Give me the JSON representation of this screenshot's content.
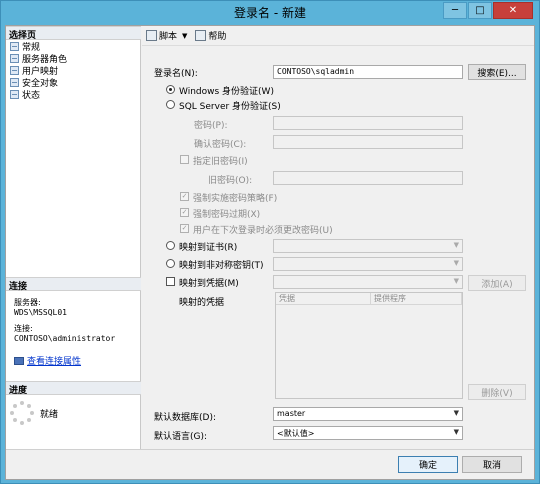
{
  "window": {
    "title": "登录名 - 新建",
    "minimize": "─",
    "maximize": "□",
    "close": "✕"
  },
  "left": {
    "pages_header": "选择页",
    "pages": [
      "常规",
      "服务器角色",
      "用户映射",
      "安全对象",
      "状态"
    ],
    "connection_header": "连接",
    "server_label": "服务器:",
    "server_value": "WDS\\MSSQL01",
    "connection_label": "连接:",
    "connection_value": "CONTOSO\\administrator",
    "view_props_link": "查看连接属性",
    "progress_header": "进度",
    "progress_status": "就绪"
  },
  "toolbar": {
    "script": "脚本",
    "script_arrow": "▼",
    "help": "帮助"
  },
  "form": {
    "login_name_label": "登录名(N):",
    "login_name_value": "CONTOSO\\sqladmin",
    "search_button": "搜索(E)...",
    "windows_auth": "Windows 身份验证(W)",
    "sql_auth": "SQL Server 身份验证(S)",
    "password_label": "密码(P):",
    "confirm_password_label": "确认密码(C):",
    "specify_old_password": "指定旧密码(I)",
    "old_password_label": "旧密码(O):",
    "enforce_policy": "强制实施密码策略(F)",
    "enforce_expiration": "强制密码过期(X)",
    "must_change": "用户在下次登录时必须更改密码(U)",
    "map_certificate": "映射到证书(R)",
    "map_asymmetric_key": "映射到非对称密钥(T)",
    "map_credential": "映射到凭据(M)",
    "add_button": "添加(A)",
    "mapped_credentials_label": "映射的凭据",
    "grid_columns": [
      "凭据",
      "提供程序"
    ],
    "remove_button": "删除(V)",
    "default_db_label": "默认数据库(D):",
    "default_db_value": "master",
    "default_lang_label": "默认语言(G):",
    "default_lang_value": "<默认值>"
  },
  "footer": {
    "ok": "确定",
    "cancel": "取消"
  }
}
